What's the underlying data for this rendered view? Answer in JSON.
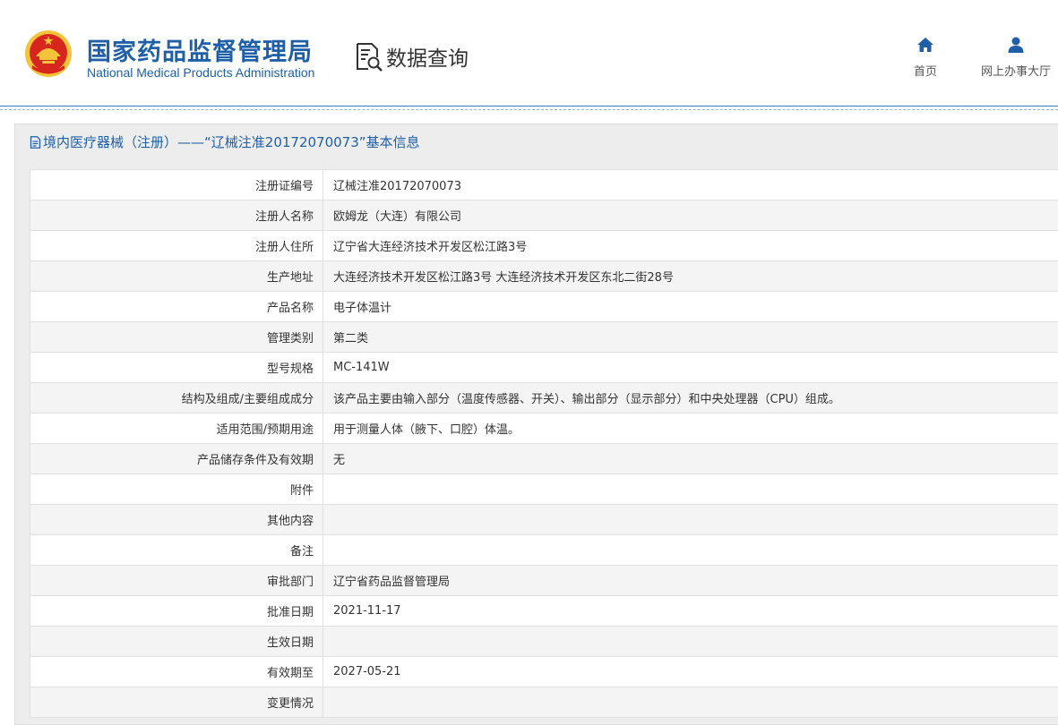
{
  "header": {
    "org_name_cn": "国家药品监督管理局",
    "org_name_en": "National Medical Products Administration",
    "logo_icon": "national-emblem-icon",
    "data_query_label": "数据查询",
    "data_query_icon": "document-search-icon",
    "nav": [
      {
        "label": "首页",
        "icon": "home-icon"
      },
      {
        "label": "网上办事大厅",
        "icon": "user-icon"
      }
    ]
  },
  "panel": {
    "title": "境内医疗器械（注册）——“辽械注准20172070073”基本信息",
    "title_icon": "document-icon"
  },
  "table": {
    "rows": [
      {
        "label": "注册证编号",
        "value": "辽械注准20172070073"
      },
      {
        "label": "注册人名称",
        "value": "欧姆龙（大连）有限公司"
      },
      {
        "label": "注册人住所",
        "value": "辽宁省大连经济技术开发区松江路3号"
      },
      {
        "label": "生产地址",
        "value": "大连经济技术开发区松江路3号 大连经济技术开发区东北二街28号"
      },
      {
        "label": "产品名称",
        "value": "电子体温计"
      },
      {
        "label": "管理类别",
        "value": "第二类"
      },
      {
        "label": "型号规格",
        "value": "MC-141W"
      },
      {
        "label": "结构及组成/主要组成成分",
        "value": "该产品主要由输入部分（温度传感器、开关）、输出部分（显示部分）和中央处理器（CPU）组成。"
      },
      {
        "label": "适用范围/预期用途",
        "value": "用于测量人体（腋下、口腔）体温。"
      },
      {
        "label": "产品储存条件及有效期",
        "value": "无"
      },
      {
        "label": "附件",
        "value": ""
      },
      {
        "label": "其他内容",
        "value": ""
      },
      {
        "label": "备注",
        "value": ""
      },
      {
        "label": "审批部门",
        "value": "辽宁省药品监督管理局"
      },
      {
        "label": "批准日期",
        "value": "2021-11-17"
      },
      {
        "label": "生效日期",
        "value": ""
      },
      {
        "label": "有效期至",
        "value": "2027-05-21"
      },
      {
        "label": "变更情况",
        "value": ""
      }
    ]
  },
  "colors": {
    "brand_blue": "#1f5fa8",
    "emblem_red": "#d7261e",
    "emblem_gold": "#f3c33a"
  }
}
